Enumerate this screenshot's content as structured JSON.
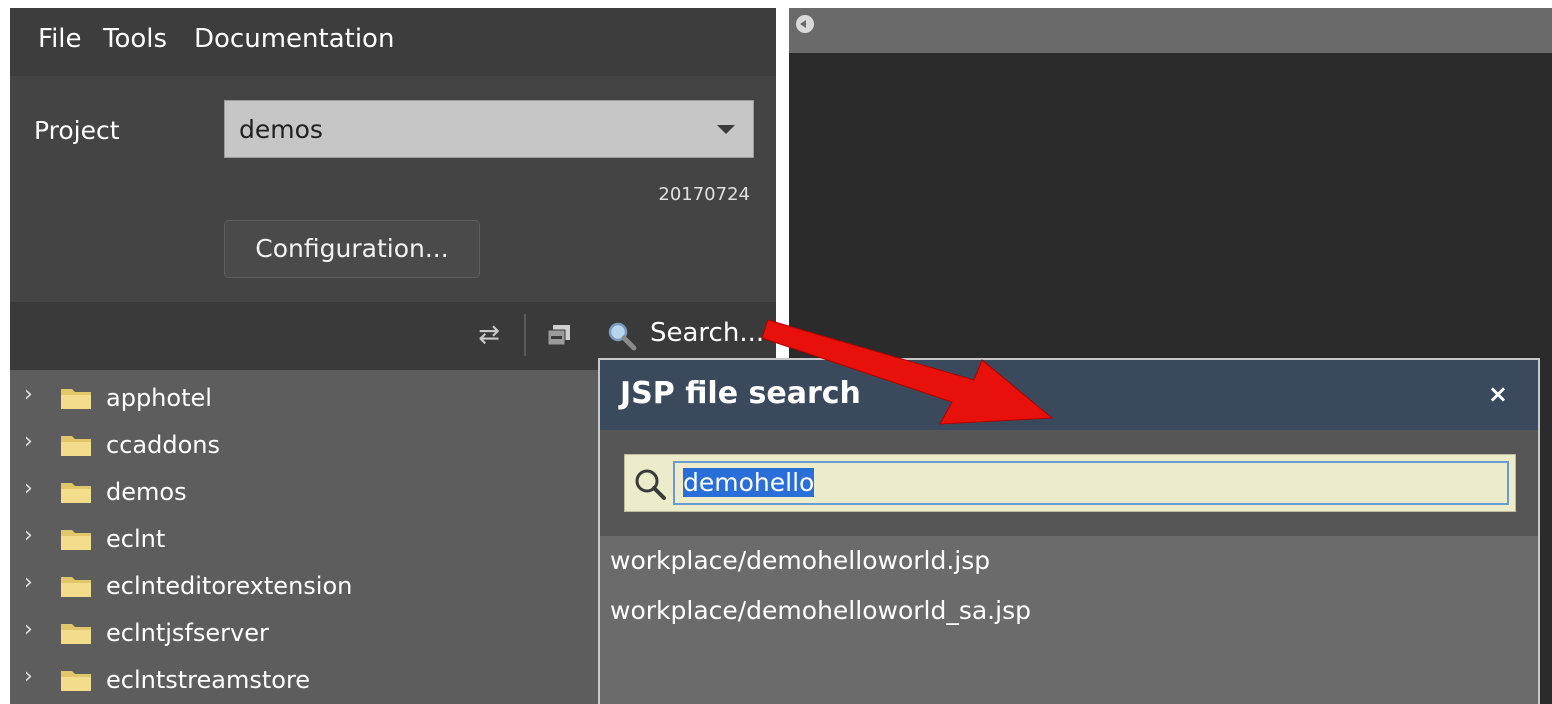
{
  "menu": [
    "File",
    "Tools",
    "Documentation"
  ],
  "project": {
    "label": "Project",
    "selected": "demos",
    "version": "20170724",
    "config_button": "Configuration..."
  },
  "toolbar": {
    "search_label": "Search..."
  },
  "tree": {
    "items": [
      {
        "label": "apphotel"
      },
      {
        "label": "ccaddons"
      },
      {
        "label": "demos"
      },
      {
        "label": "eclnt"
      },
      {
        "label": "eclnteditorextension"
      },
      {
        "label": "eclntjsfserver"
      },
      {
        "label": "eclntstreamstore"
      }
    ]
  },
  "dialog": {
    "title": "JSP file search",
    "close_symbol": "×",
    "query": "demohello",
    "results": [
      "workplace/demohelloworld.jsp",
      "workplace/demohelloworld_sa.jsp"
    ]
  },
  "colors": {
    "annotation_arrow": "#e8100a",
    "dialog_header": "#3a4a5c",
    "search_field": "#ecebca",
    "selection": "#2a6fd8"
  }
}
